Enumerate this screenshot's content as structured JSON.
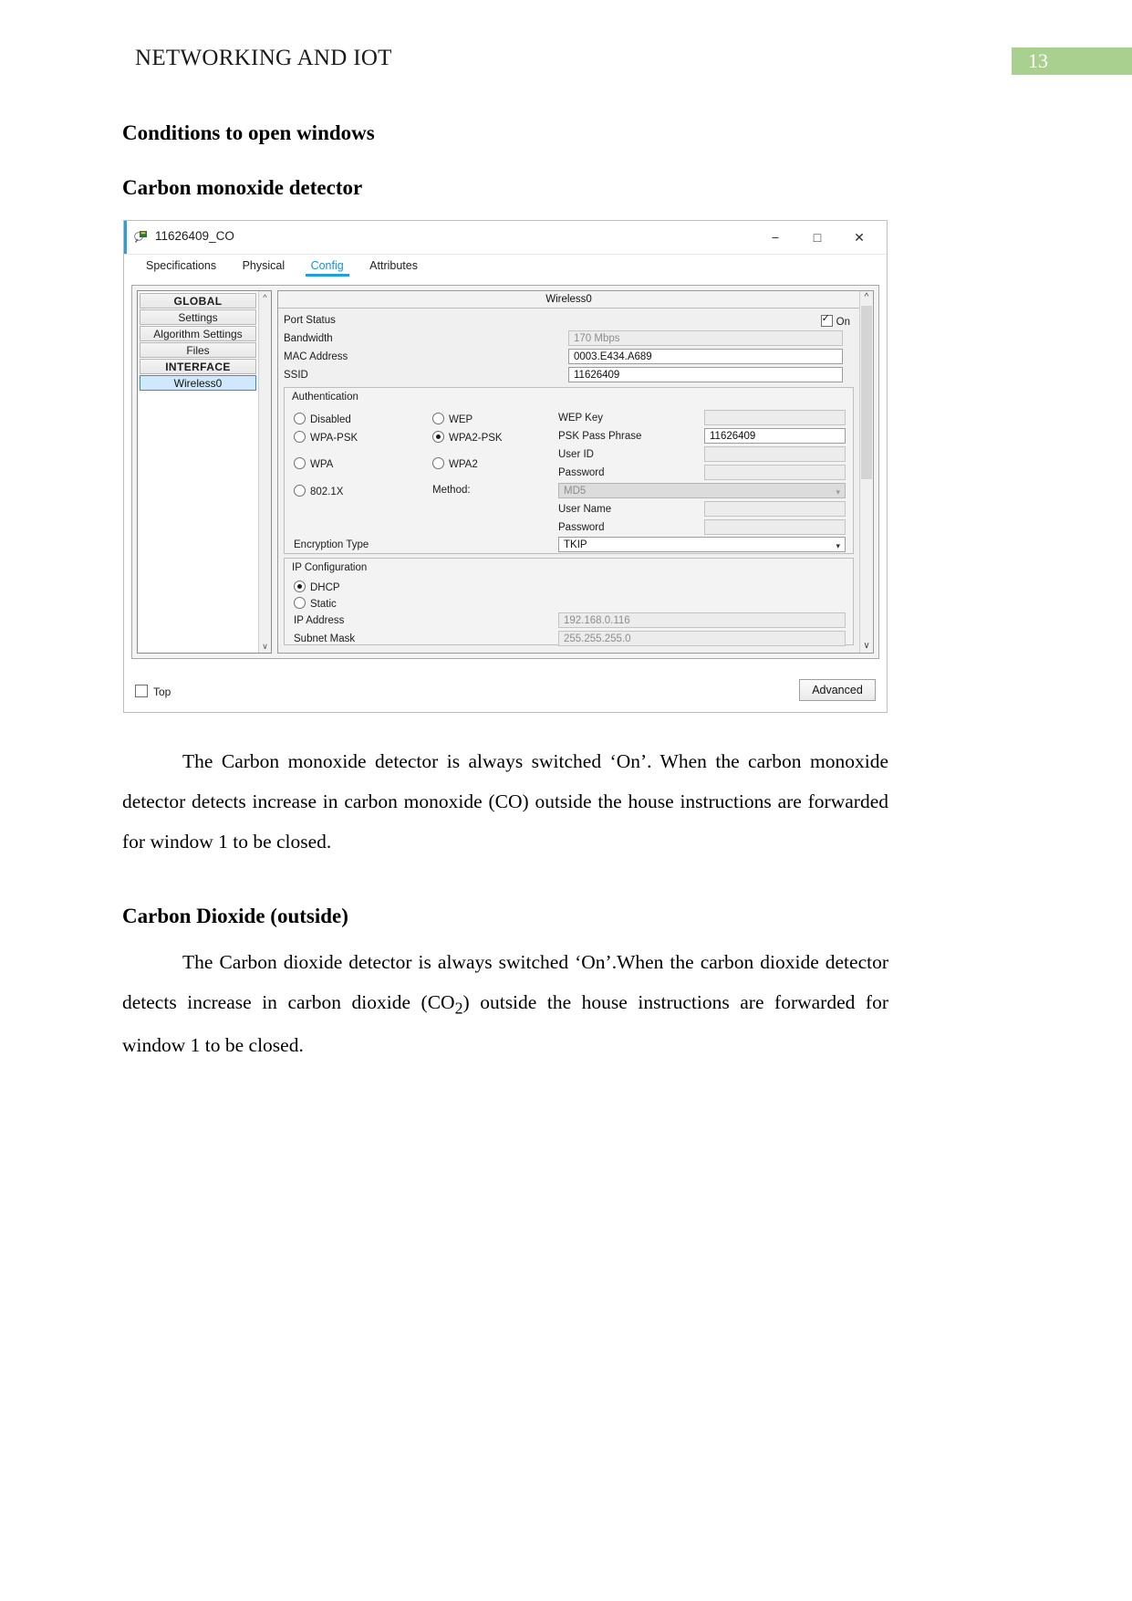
{
  "document": {
    "running_head": "NETWORKING AND IOT",
    "page_number": "13",
    "page_number_bg": "#a9d08e",
    "headings": {
      "h1": "Conditions to open windows",
      "h2": "Carbon monoxide detector",
      "h3": "Carbon Dioxide (outside)"
    },
    "paragraphs": {
      "p1": "The Carbon monoxide detector is always switched ‘On’. When the carbon monoxide detector detects increase in carbon monoxide (CO) outside the house instructions are forwarded for window 1 to be closed.",
      "p2_part1": "The Carbon dioxide detector is always switched ‘On’.When the carbon dioxide detector detects increase in carbon dioxide (CO",
      "p2_sub": "2",
      "p2_part2": ") outside the house instructions are forwarded for window 1 to be closed."
    }
  },
  "screenshot": {
    "window": {
      "title": "11626409_CO",
      "icon": "packet-tracer-icon",
      "minimize": "−",
      "maximize": "□",
      "close": "✕"
    },
    "tabs": [
      {
        "label": "Specifications",
        "active": false
      },
      {
        "label": "Physical",
        "active": false
      },
      {
        "label": "Config",
        "active": true
      },
      {
        "label": "Attributes",
        "active": false
      }
    ],
    "accent_color": "#1e9fe0",
    "sidebar": [
      {
        "label": "GLOBAL",
        "type": "group"
      },
      {
        "label": "Settings",
        "type": "item"
      },
      {
        "label": "Algorithm Settings",
        "type": "item"
      },
      {
        "label": "Files",
        "type": "item"
      },
      {
        "label": "INTERFACE",
        "type": "group"
      },
      {
        "label": "Wireless0",
        "type": "item",
        "selected": true
      }
    ],
    "panel": {
      "header": "Wireless0",
      "port_status": {
        "label": "Port Status",
        "checkbox_label": "On",
        "checked": true
      },
      "bandwidth": {
        "label": "Bandwidth",
        "value": "170 Mbps"
      },
      "mac_address": {
        "label": "MAC Address",
        "value": "0003.E434.A689"
      },
      "ssid": {
        "label": "SSID",
        "value": "11626409"
      },
      "authentication": {
        "title": "Authentication",
        "options": [
          {
            "label": "Disabled",
            "selected": false
          },
          {
            "label": "WEP",
            "selected": false
          },
          {
            "label": "WPA-PSK",
            "selected": false
          },
          {
            "label": "WPA2-PSK",
            "selected": true
          },
          {
            "label": "WPA",
            "selected": false
          },
          {
            "label": "WPA2",
            "selected": false
          },
          {
            "label": "802.1X",
            "selected": false
          }
        ],
        "method_label": "Method:",
        "method_value": "MD5",
        "fields": [
          {
            "label": "WEP Key",
            "value": ""
          },
          {
            "label": "PSK Pass Phrase",
            "value": "11626409"
          },
          {
            "label": "User ID",
            "value": ""
          },
          {
            "label": "Password",
            "value": ""
          },
          {
            "label": "User Name",
            "value": ""
          },
          {
            "label": "Password",
            "value": ""
          }
        ],
        "encryption_type": {
          "label": "Encryption Type",
          "value": "TKIP"
        }
      },
      "ip_configuration": {
        "title": "IP Configuration",
        "options": [
          {
            "label": "DHCP",
            "selected": true
          },
          {
            "label": "Static",
            "selected": false
          }
        ],
        "ip_address": {
          "label": "IP Address",
          "value": "192.168.0.116"
        },
        "subnet_mask": {
          "label": "Subnet Mask",
          "value": "255.255.255.0"
        }
      }
    },
    "footer": {
      "top_checkbox_label": "Top",
      "advanced_button": "Advanced"
    }
  }
}
